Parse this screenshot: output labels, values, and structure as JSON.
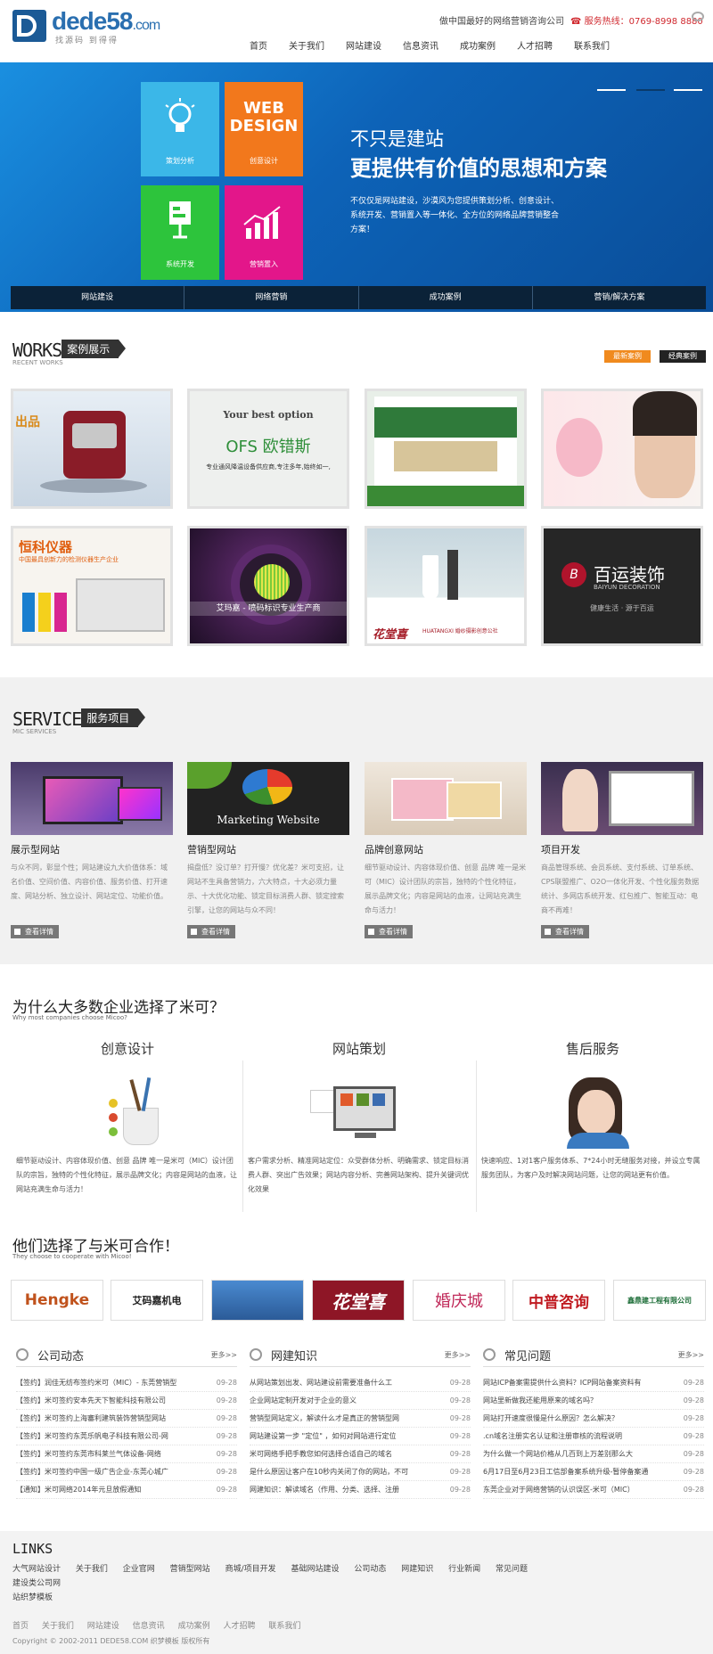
{
  "header": {
    "logo_text": "dede58",
    "logo_domain": ".com",
    "logo_sub": "找源码 到得得",
    "slogan": "做中国最好的网络营销咨询公司",
    "hotline": "服务热线：0769-8998 8880",
    "nav": [
      "首页",
      "关于我们",
      "网站建设",
      "信息资讯",
      "成功案例",
      "人才招聘",
      "联系我们"
    ]
  },
  "banner": {
    "tiles": [
      "策划分析",
      "创意设计",
      "系统开发",
      "营销置入"
    ],
    "web_design": "WEB DESIGN",
    "headline1": "不只是建站",
    "headline2": "更提供有价值的思想和方案",
    "description": "不仅仅是网站建设，沙漠风为您提供策划分析、创意设计、系统开发、营销置入等一体化、全方位的网络品牌营销整合方案！",
    "tabs": [
      "网站建设",
      "网络营销",
      "成功案例",
      "营销/解决方案"
    ]
  },
  "works": {
    "title_en": "WORKS",
    "title_cn": "案例展示",
    "subtitle": "RECENT WORKS",
    "tab_latest": "最新案例",
    "tab_classic": "经典案例",
    "items": [
      {
        "caption": "出品"
      },
      {
        "caption": "Your best option",
        "caption2": "OFS 欧错斯",
        "caption3": "专业通风降温设备供应商,专注多年,始终如一,"
      },
      {
        "caption": ""
      },
      {
        "caption": ""
      },
      {
        "caption": "恒科仪器",
        "caption2": "中国最具创新力的检测仪器生产企业"
      },
      {
        "caption": "艾玛嘉 - 喷码标识专业生产商"
      },
      {
        "caption": "花堂喜",
        "caption2": "HUATANGXI 婚纱摄影创意公社"
      },
      {
        "caption": "百运装饰",
        "caption2": "BAIYUN DECORATION",
        "caption3": "健康生活 · 源于百运"
      }
    ]
  },
  "service": {
    "title_en": "SERVICE",
    "title_cn": "服务项目",
    "subtitle": "MIC SERVICES",
    "items": [
      {
        "title": "展示型网站",
        "desc": "与众不同，彰显个性；网站建设九大价值体系：域名价值、空间价值、内容价值、服务价值、打开速度、网站分析、独立设计、网站定位、功能价值。",
        "more": "查看详情"
      },
      {
        "title": "营销型网站",
        "desc": "揭盘低？没订单？打开慢？优化差？米可支招，让网站不生具备营销力，六大特点，十大必须力量示、十大优化功能、锁定目标消费人群、锁定搜索引擎，让您的网站与众不同！",
        "more": "查看详情",
        "pic_text": "Marketing Website"
      },
      {
        "title": "品牌创意网站",
        "desc": "细节驱动设计、内容体现价值、创意 品牌 唯一是米可（MIC）设计团队的宗旨，独特的个性化特征，展示品牌文化；内容是网站的血液，让网站充满生命与活力！",
        "more": "查看详情"
      },
      {
        "title": "项目开发",
        "desc": "商品管理系统、会员系统、支付系统、订单系统、CPS联盟推广、O2O一体化开发、个性化服务数据统计、多网店系统开发、红包推广、智能互动：电商不再难！",
        "more": "查看详情"
      }
    ]
  },
  "why": {
    "title": "为什么大多数企业选择了米可？",
    "subtitle": "Why most companies choose Micoo?",
    "cols": [
      {
        "title": "创意设计",
        "desc": "细节驱动设计、内容体现价值、创意 品牌 唯一是米可（MIC）设计团队的宗旨，独特的个性化特征，展示品牌文化；内容是网站的血液，让网站充满生命与活力！"
      },
      {
        "title": "网站策划",
        "desc": "客户需求分析、精准网站定位：众受群体分析、明确需求、锁定目标消费人群、突出广告效果；网站内容分析、完善网站架构、提升关键词优化效果"
      },
      {
        "title": "售后服务",
        "desc": "快速响应、1对1客户服务体系、7*24小时无缝服务对接，并设立专属服务团队，为客户及时解决网站问题，让您的网站更有价值。"
      }
    ]
  },
  "partners": {
    "title": "他们选择了与米可合作！",
    "subtitle": "They choose to cooperate with Micoo!",
    "logos": [
      "Hengke",
      "艾码嘉机电",
      "",
      "花堂喜",
      "婚庆城",
      "中普咨询",
      "鑫鼎建工程有限公司"
    ]
  },
  "news": [
    {
      "title": "公司动态",
      "more": "更多>>",
      "items": [
        {
          "t": "【签约】润佳无纺布签约米可（MIC）- 东莞营销型",
          "d": "09-28"
        },
        {
          "t": "【签约】米可签约安本先天下智能科技有限公司",
          "d": "09-28"
        },
        {
          "t": "【签约】米可签约上海審利建筑装饰营销型网站",
          "d": "09-28"
        },
        {
          "t": "【签约】米可签约东莞乐帆电子科技有限公司-网",
          "d": "09-28"
        },
        {
          "t": "【签约】米可签约东莞市科莱兰气体设备-网络",
          "d": "09-28"
        },
        {
          "t": "【签约】米可签约中国一级广告企业-东莞心城广",
          "d": "09-28"
        },
        {
          "t": "【通知】米可网络2014年元旦放假通知",
          "d": "09-28"
        }
      ]
    },
    {
      "title": "网建知识",
      "more": "更多>>",
      "items": [
        {
          "t": "从网站策划出发、网站建设前需要准备什么工",
          "d": "09-28"
        },
        {
          "t": "企业网站定制开发对于企业的意义",
          "d": "09-28"
        },
        {
          "t": "营销型网站定义，解读什么才是真正的营销型网",
          "d": "09-28"
        },
        {
          "t": "网站建设第一步 \"定位\" ，如何对网站进行定位",
          "d": "09-28"
        },
        {
          "t": "米可网络手把手教您如何选择合适自己的域名",
          "d": "09-28"
        },
        {
          "t": "是什么原因让客户在10秒内关闭了你的网站，不可",
          "d": "09-28"
        },
        {
          "t": "网建知识：解读域名（作用、分类、选择、注册",
          "d": "09-28"
        }
      ]
    },
    {
      "title": "常见问题",
      "more": "更多>>",
      "items": [
        {
          "t": "网站ICP备案需提供什么资料？ICP网站备案资料有",
          "d": "09-28"
        },
        {
          "t": "网站里新做我还能用原来的域名吗？",
          "d": "09-28"
        },
        {
          "t": "网站打开速度很慢是什么原因？怎么解决？",
          "d": "09-28"
        },
        {
          "t": ".cn域名注册实名认证和注册审核的流程说明",
          "d": "09-28"
        },
        {
          "t": "为什么做一个网站价格从几百到上万差别那么大",
          "d": "09-28"
        },
        {
          "t": "6月17日至6月23日工信部备案系统升级-暂停备案通",
          "d": "09-28"
        },
        {
          "t": "东莞企业对于网络营销的认识误区-米可（MIC）",
          "d": "09-28"
        }
      ]
    }
  ],
  "links": {
    "title": "LINKS",
    "items": [
      "大气网站设计",
      "关于我们",
      "企业官网",
      "营销型网站",
      "商城/项目开发",
      "基础网站建设",
      "公司动态",
      "网建知识",
      "行业新闻",
      "常见问题",
      "建设类公司网",
      "站织梦模板"
    ]
  },
  "footer": {
    "nav": [
      "首页",
      "关于我们",
      "网站建设",
      "信息资讯",
      "成功案例",
      "人才招聘",
      "联系我们"
    ],
    "copyright": "Copyright © 2002-2011 DEDE58.COM 织梦模板 版权所有"
  },
  "colors": {
    "accent": "#0d63b8",
    "orange": "#f08a1e",
    "hotline": "#d0282e"
  }
}
